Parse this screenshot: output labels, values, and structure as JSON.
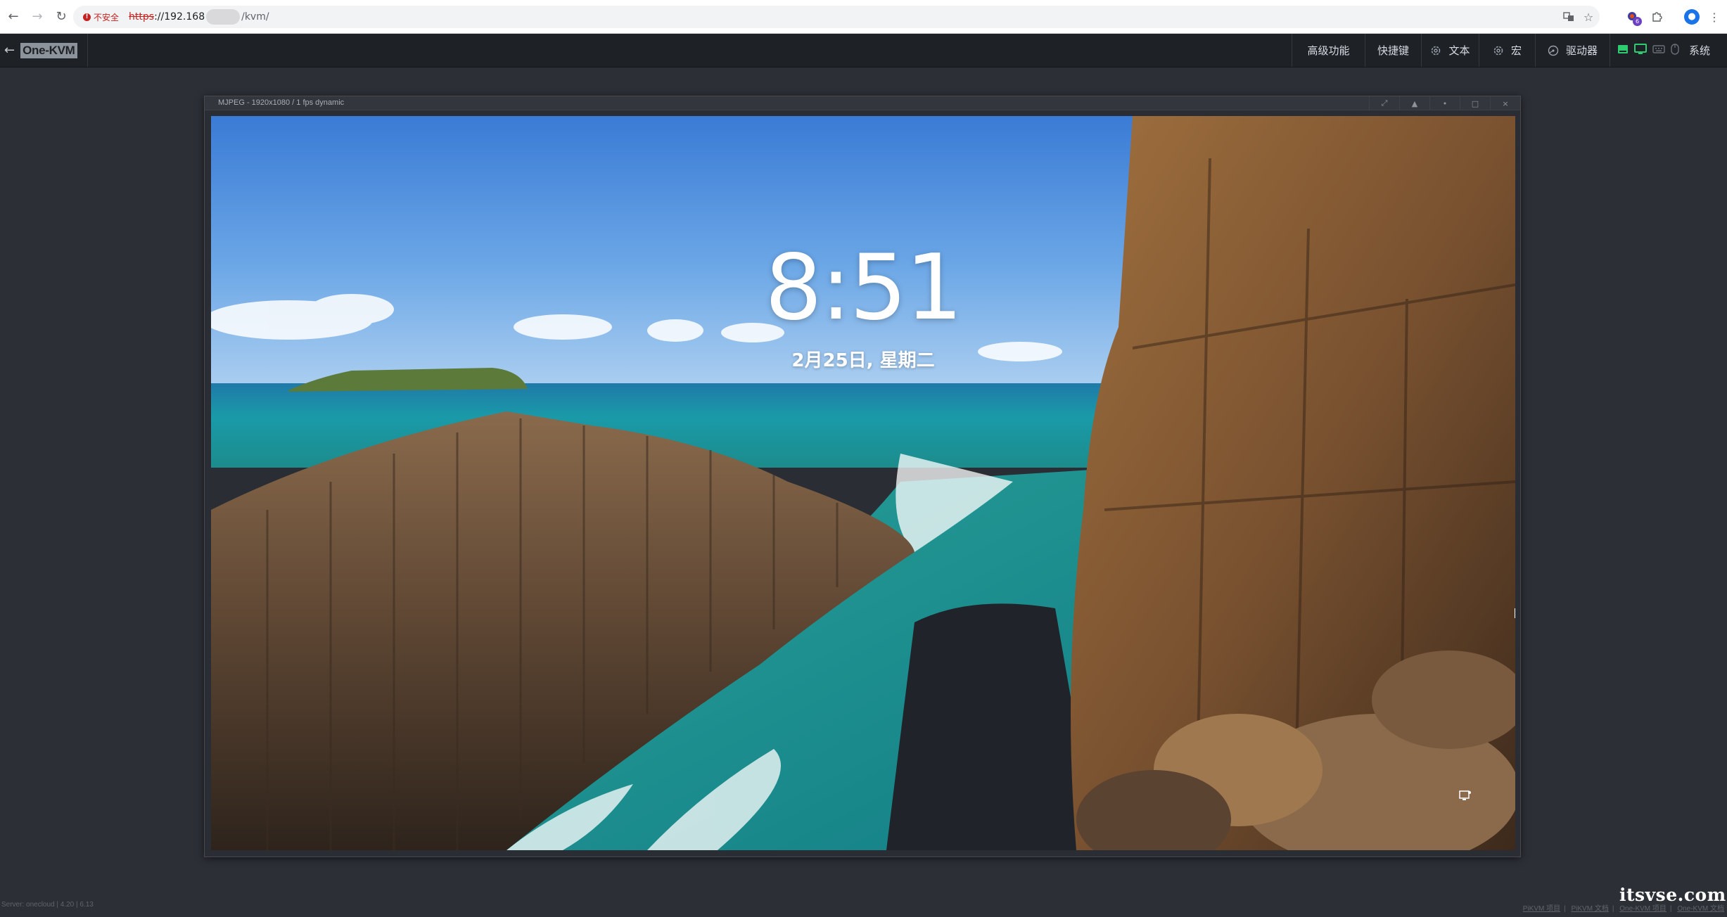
{
  "browser": {
    "security_label": "不安全",
    "url_protocol": "https",
    "url_host": "://192.168",
    "url_path": "/kvm/",
    "ext_badge": "6"
  },
  "kvm_nav": {
    "logo": "One-KVM",
    "back_arrow": "←",
    "menu": {
      "advanced": "高级功能",
      "shortcuts": "快捷键",
      "text": "文本",
      "macro": "宏",
      "drive": "驱动器",
      "system": "系统"
    }
  },
  "stream": {
    "title": "MJPEG - 1920x1080 / 1 fps dynamic",
    "buttons": [
      "⤢",
      "▲",
      "•",
      "□",
      "×"
    ]
  },
  "lock_screen": {
    "time": "8:51",
    "date": "2月25日, 星期二"
  },
  "footer": {
    "server_info": "Server: onecloud  |  4.20  |  6.13",
    "links": [
      "PiKVM 项目",
      "PiKVM 文档",
      "One-KVM 项目",
      "One-KVM 文档"
    ]
  },
  "watermark": "itsvse.com",
  "colors": {
    "nav_bg": "#1e2126",
    "page_bg": "#2c2f36",
    "status_green": "#2ecc71",
    "insecure_red": "#c5221f"
  }
}
